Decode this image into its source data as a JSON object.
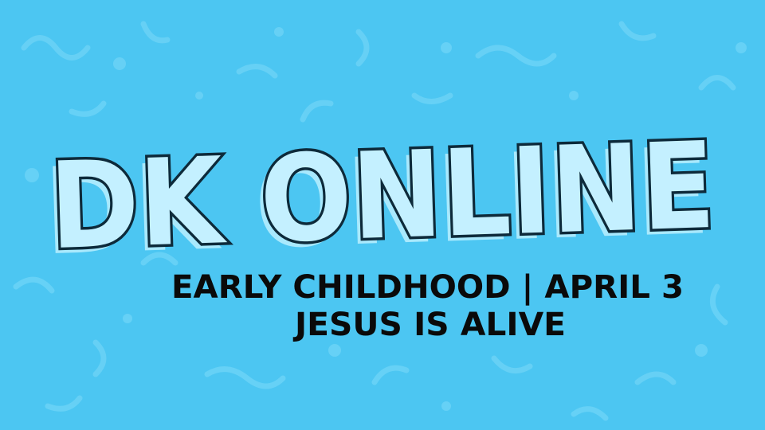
{
  "title": "DK ONLINE",
  "subtitle_line1": "EARLY CHILDHOOD | APRIL 3",
  "subtitle_line2": "JESUS IS ALIVE",
  "colors": {
    "background": "#4cc6f2",
    "squiggle": "#6dd3f6",
    "title_fill": "#c4f0ff",
    "title_stroke": "#0d2a3a",
    "title_shadow": "#a9e9fd",
    "subtitle": "#0a0a0a"
  }
}
